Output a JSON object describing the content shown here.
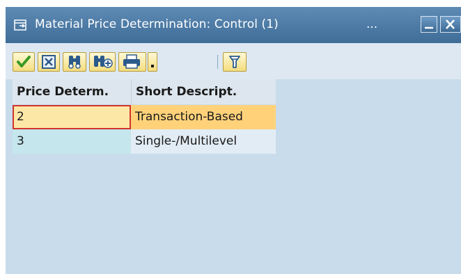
{
  "window": {
    "title": "Material Price Determination: Control (1)",
    "title_ellipsis": "...",
    "minimize_label": "_",
    "close_label": "X"
  },
  "toolbar": {
    "buttons": [
      {
        "name": "confirm-button",
        "icon": "checkmark-icon"
      },
      {
        "name": "cancel-button",
        "icon": "close-box-icon"
      },
      {
        "name": "find-button",
        "icon": "binoculars-icon"
      },
      {
        "name": "find-next-button",
        "icon": "binoculars-plus-icon"
      },
      {
        "name": "print-button",
        "icon": "printer-icon"
      },
      {
        "name": "print-options-button",
        "icon": "dropdown-arrow-icon"
      },
      {
        "name": "filter-button",
        "icon": "filter-icon"
      }
    ]
  },
  "table": {
    "columns": [
      "Price Determ.",
      "Short Descript."
    ],
    "rows": [
      {
        "code": "2",
        "description": "Transaction-Based",
        "selected": true
      },
      {
        "code": "3",
        "description": "Single-/Multilevel",
        "selected": false
      }
    ]
  },
  "colors": {
    "title_bar": "#4a78a3",
    "body_background": "#c8dcec",
    "selected_row": "#ffd27a",
    "selected_key_cell": "#fde7a7",
    "key_cell": "#c4e6ec",
    "value_cell": "#e2ecf4",
    "focus_border": "#d0342c"
  }
}
